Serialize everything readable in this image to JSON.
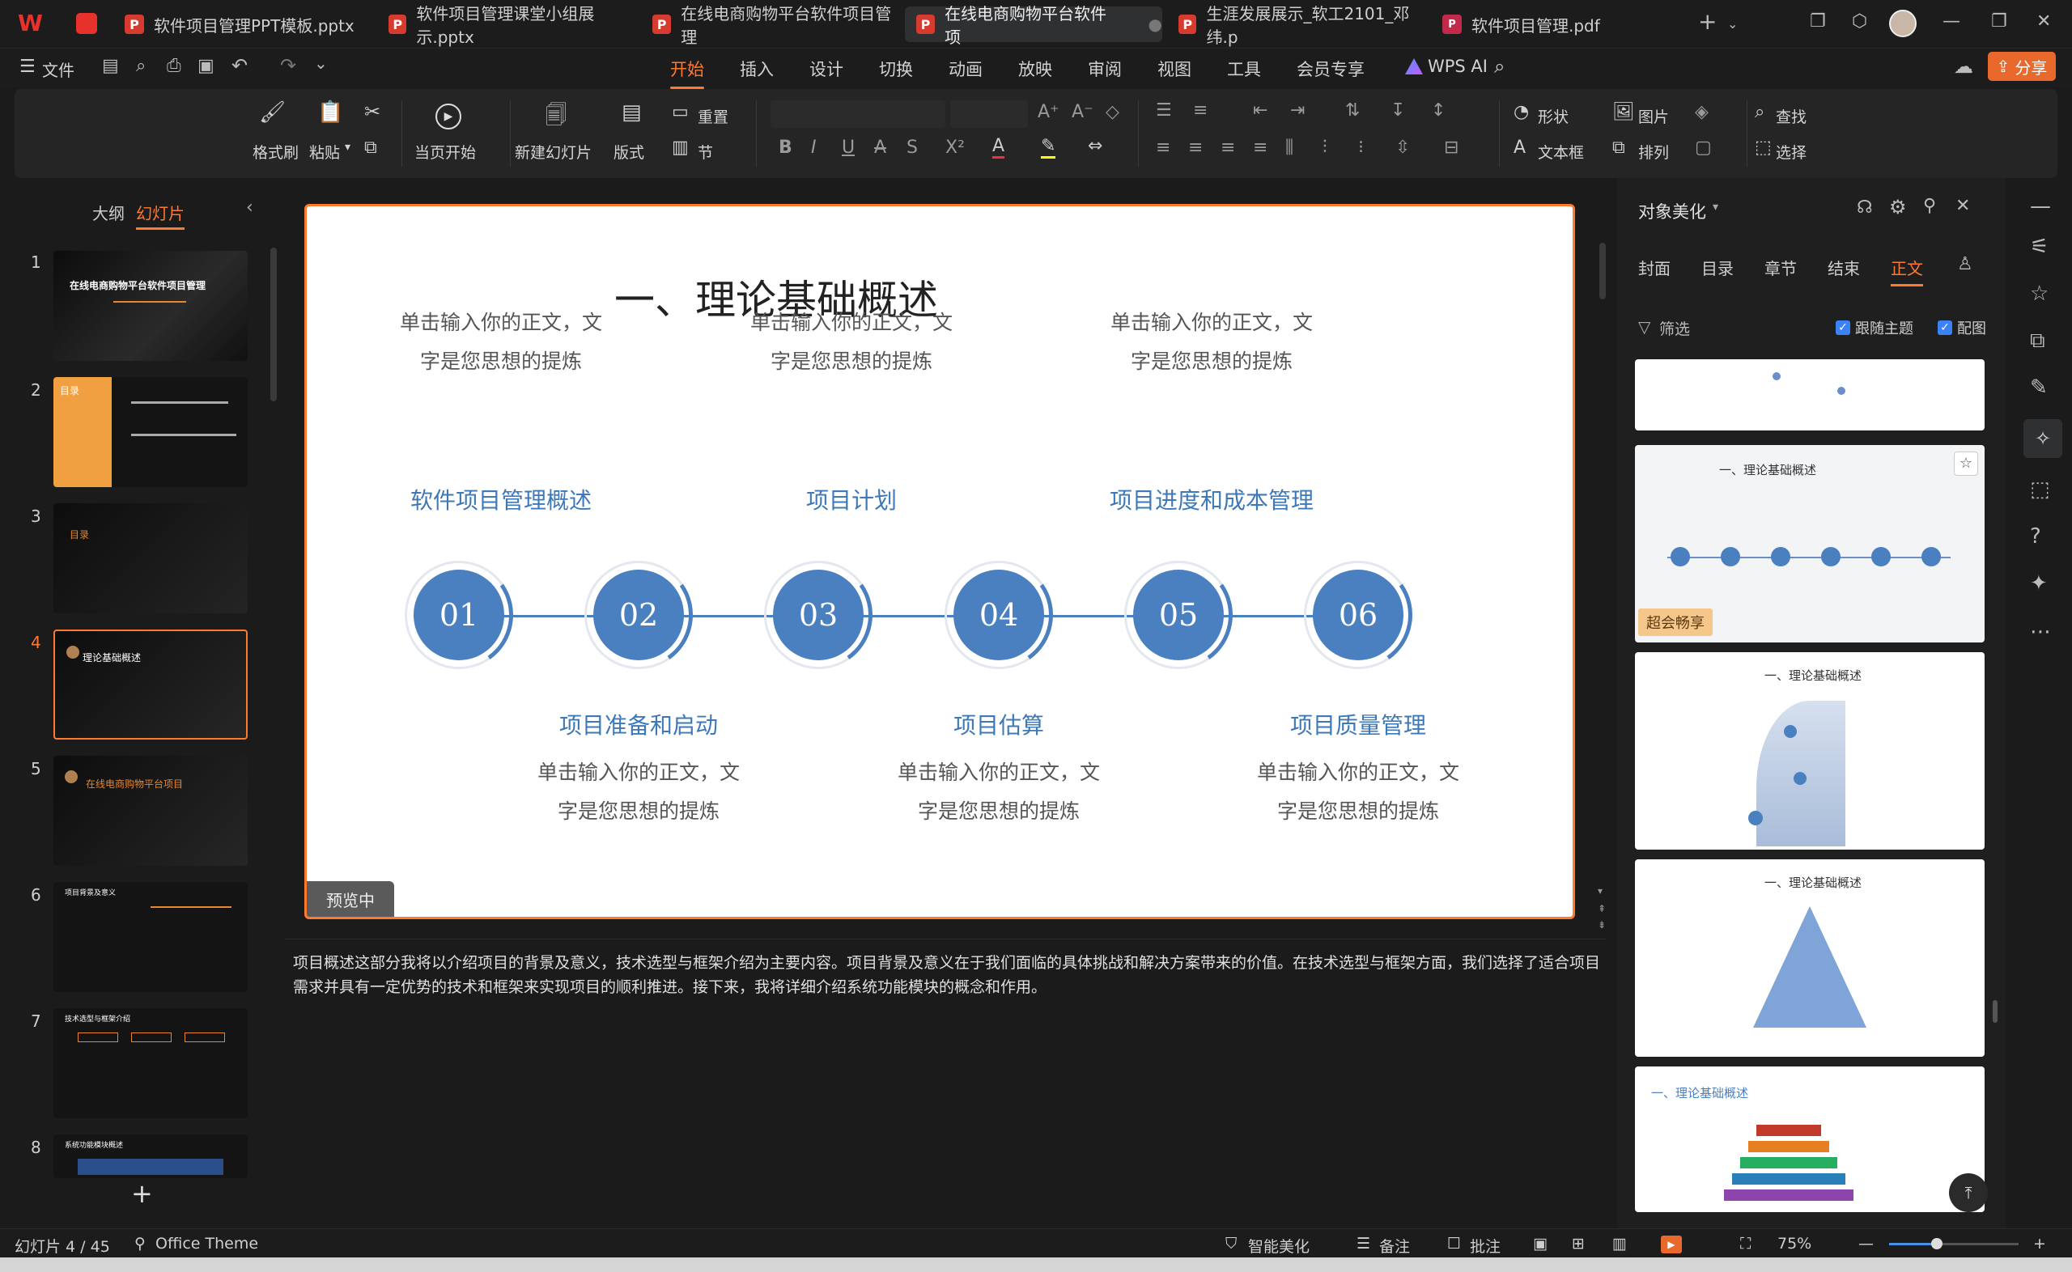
{
  "tabs": [
    {
      "label": "软件项目管理PPT模板.pptx",
      "type": "ppt"
    },
    {
      "label": "软件项目管理课堂小组展示.pptx",
      "type": "ppt"
    },
    {
      "label": "在线电商购物平台软件项目管理",
      "type": "ppt"
    },
    {
      "label": "在线电商购物平台软件项",
      "type": "ppt"
    },
    {
      "label": "生涯发展展示_软工2101_邓纬.p",
      "type": "ppt"
    },
    {
      "label": "软件项目管理.pdf",
      "type": "pdf"
    }
  ],
  "menu": {
    "file": "文件",
    "tabs": [
      "开始",
      "插入",
      "设计",
      "切换",
      "动画",
      "放映",
      "审阅",
      "视图",
      "工具",
      "会员专享"
    ],
    "wps_ai": "WPS AI",
    "share": "分享"
  },
  "ribbon": {
    "format_painter": "格式刷",
    "paste": "粘贴",
    "from_current": "当页开始",
    "new_slide": "新建幻灯片",
    "layout": "版式",
    "section": "节",
    "reset": "重置",
    "shape": "形状",
    "picture": "图片",
    "textbox": "文本框",
    "arrange": "排列",
    "find": "查找",
    "select": "选择"
  },
  "left_panel": {
    "outline": "大纲",
    "slides": "幻灯片",
    "slide_numbers": [
      "1",
      "2",
      "3",
      "4",
      "5",
      "6",
      "7",
      "8"
    ],
    "thumb_titles": [
      "在线电商购物平台软件项目管理",
      "目录",
      "目录",
      "理论基础概述",
      "在线电商购物平台项目",
      "项目背景及意义",
      "技术选型与框架介绍",
      "系统功能模块概述"
    ]
  },
  "slide": {
    "title": "一、理论基础概述",
    "top_items": [
      {
        "body1": "单击输入你的正文，文",
        "body2": "字是您思想的提炼",
        "topic": "软件项目管理概述"
      },
      {
        "body1": "单击输入你的正文，文",
        "body2": "字是您思想的提炼",
        "topic": "项目计划"
      },
      {
        "body1": "单击输入你的正文，文",
        "body2": "字是您思想的提炼",
        "topic": "项目进度和成本管理"
      }
    ],
    "numbers": [
      "01",
      "02",
      "03",
      "04",
      "05",
      "06"
    ],
    "bottom_items": [
      {
        "topic": "项目准备和启动",
        "body1": "单击输入你的正文，文",
        "body2": "字是您思想的提炼"
      },
      {
        "topic": "项目估算",
        "body1": "单击输入你的正文，文",
        "body2": "字是您思想的提炼"
      },
      {
        "topic": "项目质量管理",
        "body1": "单击输入你的正文，文",
        "body2": "字是您思想的提炼"
      }
    ],
    "preview_badge": "预览中"
  },
  "notes": "项目概述这部分我将以介绍项目的背景及意义，技术选型与框架介绍为主要内容。项目背景及意义在于我们面临的具体挑战和解决方案带来的价值。在技术选型与框架方面，我们选择了适合项目需求并具有一定优势的技术和框架来实现项目的顺利推进。接下来，我将详细介绍系统功能模块的概念和作用。",
  "right_panel": {
    "title": "对象美化",
    "tabs": [
      "封面",
      "目录",
      "章节",
      "结束",
      "正文"
    ],
    "filter": "筛选",
    "follow_theme": "跟随主题",
    "match_pic": "配图",
    "badge": "超会畅享",
    "card_title": "一、理论基础概述"
  },
  "status": {
    "slide_info": "幻灯片 4 / 45",
    "theme": "Office Theme",
    "smart": "智能美化",
    "notes": "备注",
    "comments": "批注",
    "zoom": "75%"
  },
  "colors": {
    "accent": "#ff7a2e",
    "slide_blue": "#4a7fc0",
    "topic_blue": "#3d78b8"
  }
}
